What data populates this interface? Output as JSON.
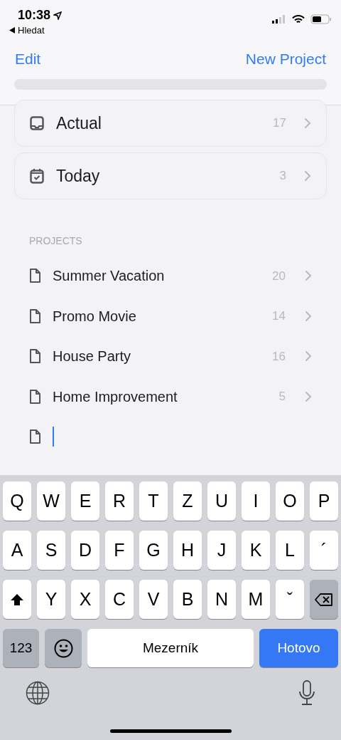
{
  "status_bar": {
    "time": "10:38",
    "back_label": "Hledat"
  },
  "nav": {
    "left": "Edit",
    "right": "New Project"
  },
  "smart_lists": [
    {
      "kind": "inbox",
      "label": "Actual",
      "count": "17"
    },
    {
      "kind": "calendar",
      "label": "Today",
      "count": "3"
    }
  ],
  "projects": {
    "header": "PROJECTS",
    "items": [
      {
        "label": "Summer Vacation",
        "count": "20"
      },
      {
        "label": "Promo Movie",
        "count": "14"
      },
      {
        "label": "House Party",
        "count": "16"
      },
      {
        "label": "Home Improvement",
        "count": "5"
      }
    ],
    "new_item": {
      "focused": true
    }
  },
  "keyboard": {
    "rows": [
      [
        {
          "kind": "char",
          "label": "Q"
        },
        {
          "kind": "char",
          "label": "W"
        },
        {
          "kind": "char",
          "label": "E"
        },
        {
          "kind": "char",
          "label": "R"
        },
        {
          "kind": "char",
          "label": "T"
        },
        {
          "kind": "char",
          "label": "Z"
        },
        {
          "kind": "char",
          "label": "U"
        },
        {
          "kind": "char",
          "label": "I"
        },
        {
          "kind": "char",
          "label": "O"
        },
        {
          "kind": "char",
          "label": "P"
        }
      ],
      [
        {
          "kind": "char",
          "label": "A"
        },
        {
          "kind": "char",
          "label": "S"
        },
        {
          "kind": "char",
          "label": "D"
        },
        {
          "kind": "char",
          "label": "F"
        },
        {
          "kind": "char",
          "label": "G"
        },
        {
          "kind": "char",
          "label": "H"
        },
        {
          "kind": "char",
          "label": "J"
        },
        {
          "kind": "char",
          "label": "K"
        },
        {
          "kind": "char",
          "label": "L"
        },
        {
          "kind": "char",
          "label": "´"
        }
      ],
      [
        {
          "kind": "shift"
        },
        {
          "kind": "char",
          "label": "Y"
        },
        {
          "kind": "char",
          "label": "X"
        },
        {
          "kind": "char",
          "label": "C"
        },
        {
          "kind": "char",
          "label": "V"
        },
        {
          "kind": "char",
          "label": "B"
        },
        {
          "kind": "char",
          "label": "N"
        },
        {
          "kind": "char",
          "label": "M"
        },
        {
          "kind": "char",
          "label": "ˇ"
        },
        {
          "kind": "backspace"
        }
      ]
    ],
    "numbers_key": "123",
    "space_key": "Mezerník",
    "done_key": "Hotovo"
  }
}
